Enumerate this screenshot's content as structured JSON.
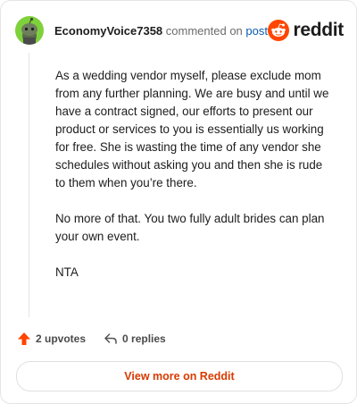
{
  "comment": {
    "username": "EconomyVoice7358",
    "commented_on": "commented on",
    "post_link": "post",
    "paragraphs": [
      "As a wedding vendor myself, please exclude mom from any further planning. We are busy and until we have a contract signed, our efforts to present our product or services to you is essentially us working for free. She is wasting the time of any vendor she schedules without asking you and then she is rude to them when you’re there.",
      "No more of that. You two fully adult brides can plan your own event.",
      "NTA"
    ],
    "upvotes": "2 upvotes",
    "replies": "0 replies"
  },
  "brand": {
    "name": "reddit",
    "color": "#ff4500"
  },
  "footer": {
    "view_more_label": "View more on Reddit"
  },
  "colors": {
    "avatar_bg": "#7fd13b",
    "accent_text": "#d93a00",
    "link": "#0b5cad"
  },
  "icons": {
    "avatar": "snoo-avatar-icon",
    "logo": "reddit-logo-icon",
    "upvote": "upvote-arrow-icon",
    "reply": "reply-arrow-icon"
  }
}
